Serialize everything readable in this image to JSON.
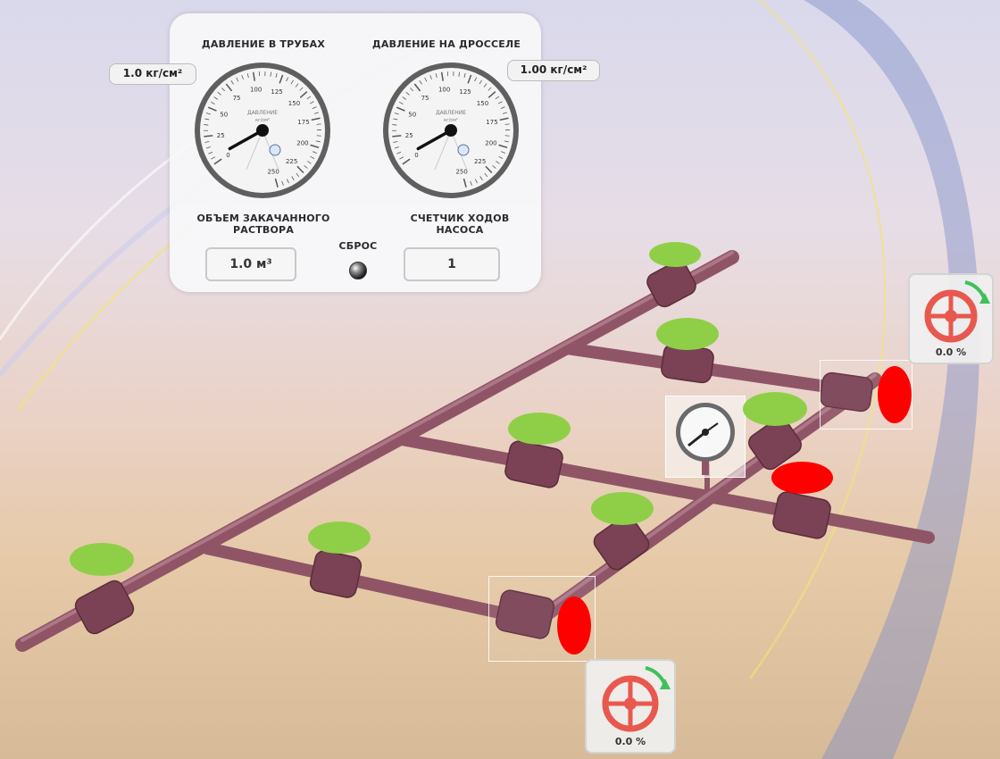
{
  "panel": {
    "gauge_left_title": "ДАВЛЕНИЕ В ТРУБАХ",
    "gauge_right_title": "ДАВЛЕНИЕ НА ДРОССЕЛЕ",
    "gauge_left_readout": "1.0 кг/см²",
    "gauge_right_readout": "1.00 кг/см²",
    "gauge_ticks": [
      "0",
      "25",
      "50",
      "75",
      "100",
      "125",
      "150",
      "175",
      "200",
      "225",
      "250"
    ],
    "gauge_brand": "ДАВЛЕНИЕ",
    "gauge_unit": "кг/см²",
    "gauge_left_value": 5,
    "gauge_right_value": 5,
    "volume_label_line1": "ОБЪЕМ ЗАКАЧАННОГО",
    "volume_label_line2": "РАСТВОРА",
    "volume_value": "1.0 м³",
    "reset_label": "СБРОС",
    "counter_label_line1": "СЧЕТЧИК ХОДОВ",
    "counter_label_line2": "НАСОСА",
    "counter_value": "1"
  },
  "valves": {
    "top_right_percent": "0.0 %",
    "bottom_percent": "0.0 %"
  },
  "colors": {
    "pipe": "#8f5566",
    "marker_open": "#8fcf48",
    "marker_closed": "#ff0000",
    "valve_wheel": "#e8584f"
  }
}
